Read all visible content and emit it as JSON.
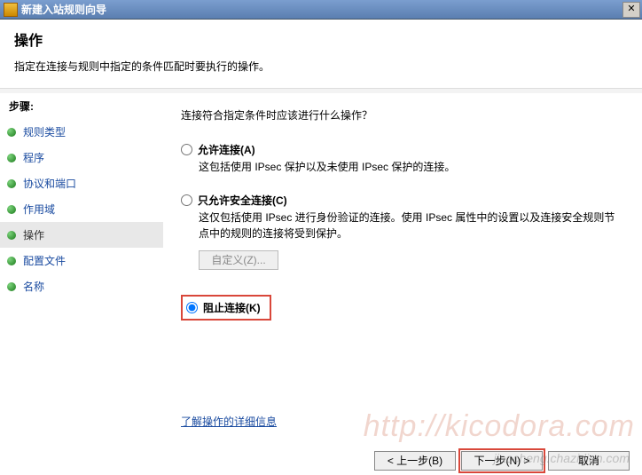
{
  "window": {
    "title": "新建入站规则向导",
    "close": "✕"
  },
  "header": {
    "title": "操作",
    "subtitle": "指定在连接与规则中指定的条件匹配时要执行的操作。"
  },
  "sidebar": {
    "steps_label": "步骤:",
    "items": [
      {
        "label": "规则类型"
      },
      {
        "label": "程序"
      },
      {
        "label": "协议和端口"
      },
      {
        "label": "作用域"
      },
      {
        "label": "操作"
      },
      {
        "label": "配置文件"
      },
      {
        "label": "名称"
      }
    ],
    "current_index": 4
  },
  "content": {
    "prompt": "连接符合指定条件时应该进行什么操作？",
    "options": {
      "allow": {
        "label": "允许连接(A)",
        "desc": "这包括使用 IPsec 保护以及未使用 IPsec 保护的连接。"
      },
      "secure": {
        "label": "只允许安全连接(C)",
        "desc": "这仅包括使用 IPsec 进行身份验证的连接。使用 IPsec 属性中的设置以及连接安全规则节点中的规则的连接将受到保护。",
        "customize": "自定义(Z)..."
      },
      "block": {
        "label": "阻止连接(K)"
      },
      "selected": "block"
    },
    "learn_more": "了解操作的详细信息"
  },
  "footer": {
    "back": "< 上一步(B)",
    "next": "下一步(N) >",
    "cancel": "取消"
  },
  "watermark": {
    "main": "http://kicodora.com",
    "sub": "jiaocheng.chazidian.com"
  }
}
